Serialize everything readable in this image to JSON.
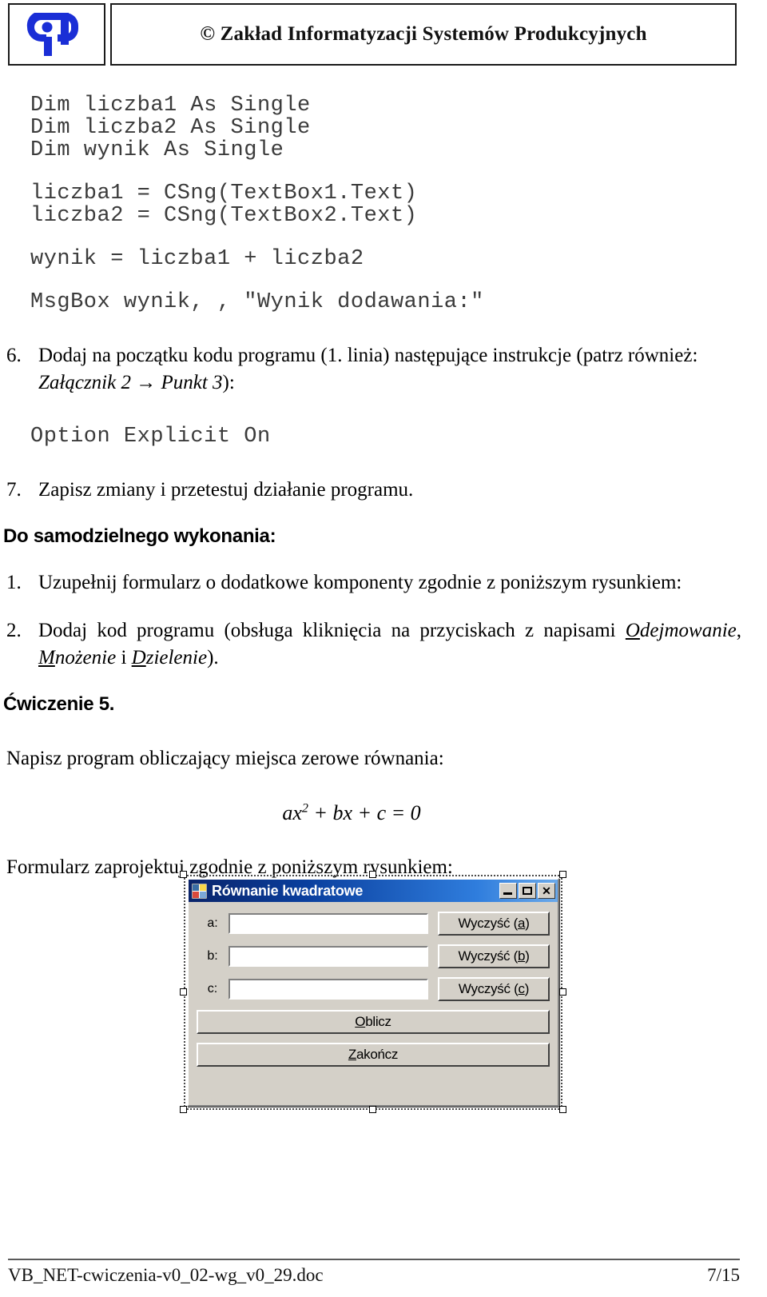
{
  "header": {
    "logo_alt": "zis-logo",
    "title": "© Zakład Informatyzacji Systemów Produkcyjnych"
  },
  "code_block_1": {
    "lines": [
      "Dim liczba1 As Single",
      "Dim liczba2 As Single",
      "Dim wynik As Single"
    ],
    "lines2": [
      "liczba1 = CSng(TextBox1.Text)",
      "liczba2 = CSng(TextBox2.Text)"
    ],
    "line3": "wynik = liczba1 + liczba2",
    "line4": "MsgBox wynik, , \"Wynik dodawania:\""
  },
  "items": {
    "item6": {
      "marker": "6.",
      "text_a": "Dodaj na początku kodu programu (1. linia) następujące instrukcje (patrz również:",
      "text_b_italic_1": "Załącznik 2",
      "arrow": "→",
      "text_b_italic_2": "Punkt 3",
      "text_b_tail": "):"
    },
    "item7": {
      "marker": "7.",
      "text": "Zapisz zmiany i przetestuj działanie programu."
    },
    "self_heading": "Do samodzielnego wykonania:",
    "item_s1": {
      "marker": "1.",
      "text": "Uzupełnij formularz o dodatkowe komponenty zgodnie z poniższym rysunkiem:"
    },
    "item_s2": {
      "marker": "2.",
      "text_a": "Dodaj kod programu (obsługa kliknięcia na przyciskach z napisami ",
      "word1_mnem": "O",
      "word1_rest": "dejmowanie",
      "sep1": ", ",
      "word2_mnem": "M",
      "word2_rest": "nożenie",
      "sep2": " i ",
      "word3_mnem": "D",
      "word3_rest": "zielenie",
      "tail": ")."
    }
  },
  "code_block_2": {
    "line": "Option Explicit On"
  },
  "exercise": {
    "heading": "Ćwiczenie 5.",
    "intro": "Napisz program obliczający miejsca zerowe równania:",
    "equation": {
      "a": "ax",
      "sup": "2",
      "plus1": " + ",
      "b": "bx",
      "plus2": " + ",
      "c": "c",
      "equals": " = ",
      "zero": "0"
    },
    "outro": "Formularz zaprojektuj zgodnie z poniższym rysunkiem:"
  },
  "dialog": {
    "title": "Równanie kwadratowe",
    "icon_name": "vb-form-icon",
    "minimize_label": "_",
    "maximize_label": "□",
    "close_label": "✕",
    "rows": [
      {
        "label": "a:",
        "value": "",
        "button_mnem": "a",
        "button_prefix": "Wyczyść (",
        "button_suffix": ")"
      },
      {
        "label": "b:",
        "value": "",
        "button_mnem": "b",
        "button_prefix": "Wyczyść (",
        "button_suffix": ")"
      },
      {
        "label": "c:",
        "value": "",
        "button_mnem": "c",
        "button_prefix": "Wyczyść (",
        "button_suffix": ")"
      }
    ],
    "compute_mnem": "O",
    "compute_rest": "blicz",
    "quit_mnem": "Z",
    "quit_rest": "akończ"
  },
  "footer": {
    "filename": "VB_NET-cwiczenia-v0_02-wg_v0_29.doc",
    "page": "7/15"
  },
  "colors": {
    "logo_blue": "#1a2ed6",
    "title_bar_dark": "#0a246a",
    "title_bar_light": "#6aa9ea",
    "dialog_face": "#d4d0c8",
    "code_gray": "#3b3b3b"
  }
}
